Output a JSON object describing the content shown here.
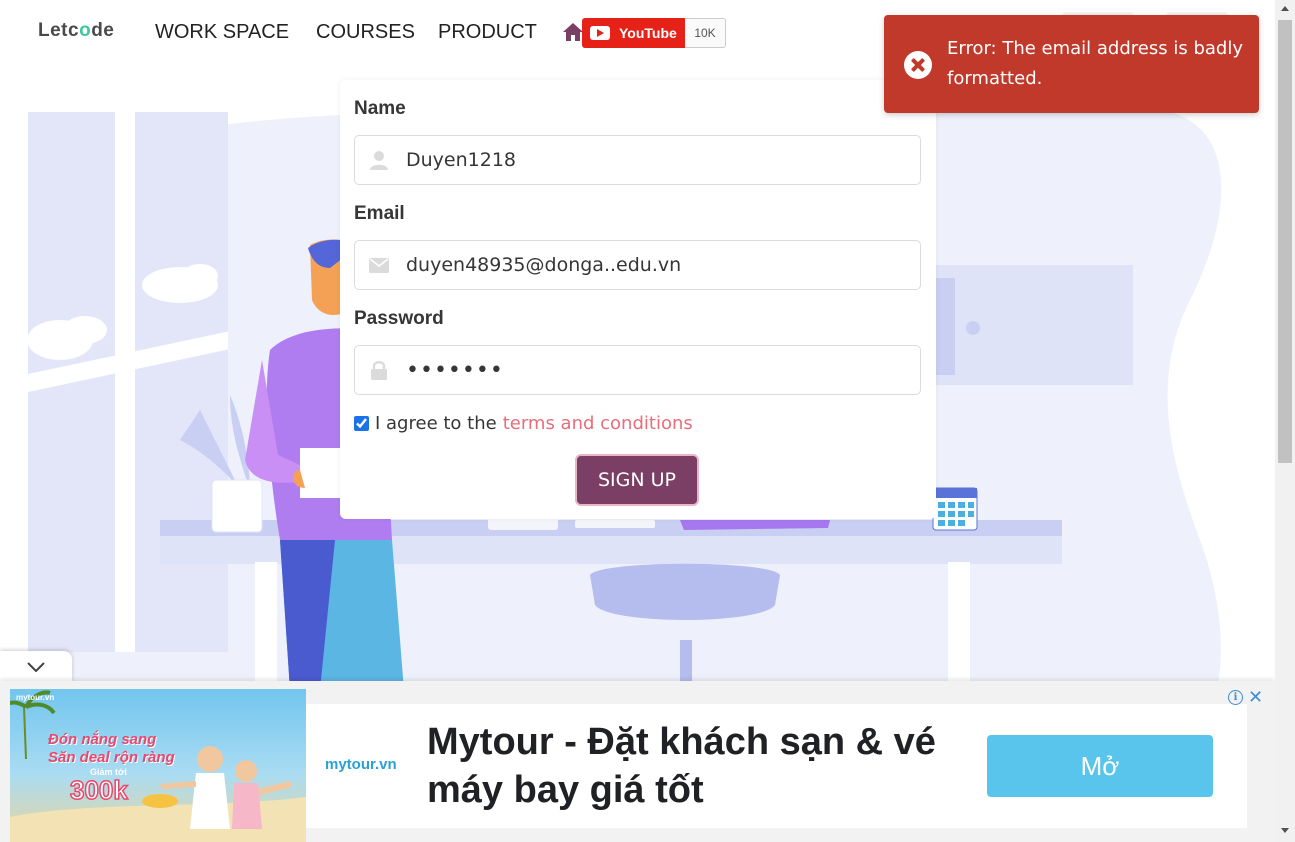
{
  "navbar": {
    "logo_pre": "Letc",
    "logo_ring": "o",
    "logo_post": "de",
    "items": [
      "WORK SPACE",
      "COURSES",
      "PRODUCT"
    ],
    "youtube_label": "YouTube",
    "youtube_count": "10K"
  },
  "form": {
    "name_label": "Name",
    "name_value": "Duyen1218",
    "email_label": "Email",
    "email_value": "duyen48935@donga..edu.vn",
    "password_label": "Password",
    "password_value": "•••••••",
    "agree_checked": true,
    "agree_text": "I agree to the",
    "terms_link": "terms and conditions",
    "submit_label": "SIGN UP"
  },
  "toast": {
    "message": "Error: The email address is badly formatted."
  },
  "ad": {
    "image_brand": "mytour.vn",
    "image_headline_1": "Đón nắng sang",
    "image_headline_2": "Săn deal rộn ràng",
    "image_discount_label": "Giảm tới",
    "image_price": "300k",
    "logo": "mytour.vn",
    "title": "Mytour - Đặt khách sạn & vé máy bay giá tốt",
    "button_label": "Mở"
  },
  "colors": {
    "toast_bg": "#c0392b",
    "signup_bg": "#7b3e64",
    "terms_link": "#e96d7b",
    "youtube_red": "#e62117",
    "ad_button": "#5ac5ec"
  }
}
